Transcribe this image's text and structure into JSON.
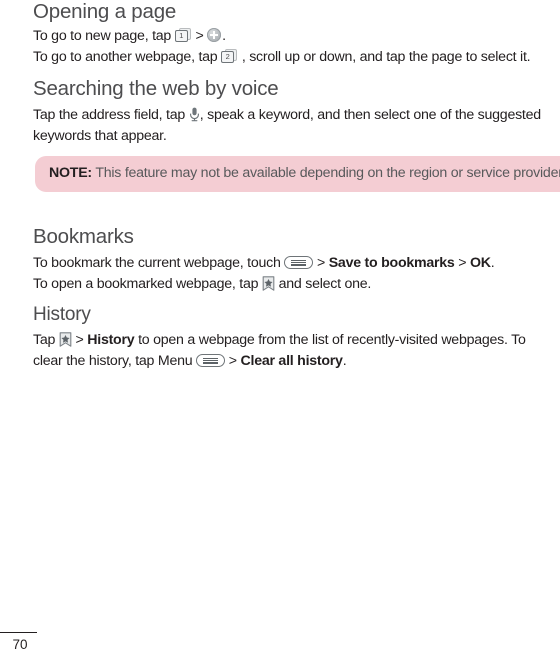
{
  "document": {
    "type": "user-manual-page",
    "page_number": "70"
  },
  "sections": [
    {
      "id": "opening-a-page",
      "heading": "Opening a page",
      "level": "major"
    },
    {
      "id": "searching-the-web-by-voice",
      "heading": "Searching the web by voice",
      "level": "major"
    },
    {
      "id": "bookmarks",
      "heading": "Bookmarks",
      "level": "major"
    },
    {
      "id": "history",
      "heading": "History",
      "level": "minor"
    }
  ],
  "opening_a_page": {
    "heading": "Opening a page",
    "line1_a": "To go to new page, tap ",
    "line1_b": " > ",
    "line1_c": ".",
    "line2_a": "To go to another webpage, tap ",
    "line2_b": " , scroll up or down, and tap the page to select it.",
    "icon_tab_count_1": "1",
    "icon_tab_count_2": "2",
    "icon_new_tab": "plus-circle-icon"
  },
  "searching_the_web_by_voice": {
    "heading": "Searching the web by voice",
    "text_a": "Tap the address field, tap ",
    "text_b": ", speak a keyword, and then select one of the suggested keywords that appear.",
    "icon_microphone": "microphone-icon"
  },
  "note": {
    "label": "NOTE:",
    "text": "This feature may not be available depending on the region or service provider.",
    "background_color": "#f4cdd3",
    "text_color": "#58595b"
  },
  "bookmarks": {
    "heading": "Bookmarks",
    "line1_a": "To bookmark the current webpage, touch ",
    "line1_b": " > ",
    "line1_bold1": "Save to bookmarks",
    "line1_c": " > ",
    "line1_bold2": "OK",
    "line1_d": ".",
    "line2_a": "To open a bookmarked webpage, tap ",
    "line2_b": " and select one.",
    "icon_menu": "menu-icon",
    "icon_bookmark": "bookmark-star-icon"
  },
  "history": {
    "heading": "History",
    "text_a": "Tap ",
    "text_b": " > ",
    "bold1": "History",
    "text_c": " to open a webpage from the list of recently-visited webpages. To clear the history, tap Menu ",
    "text_d": " > ",
    "bold2": "Clear all history",
    "text_e": ".",
    "icon_bookmark": "bookmark-star-icon",
    "icon_menu": "menu-icon"
  },
  "footer": {
    "page_number": "70"
  },
  "colors": {
    "heading": "#4d4d4f",
    "body": "#231f20",
    "note_bg": "#f4cdd3",
    "note_fg": "#58595b",
    "icon_outline": "#6e7478"
  }
}
